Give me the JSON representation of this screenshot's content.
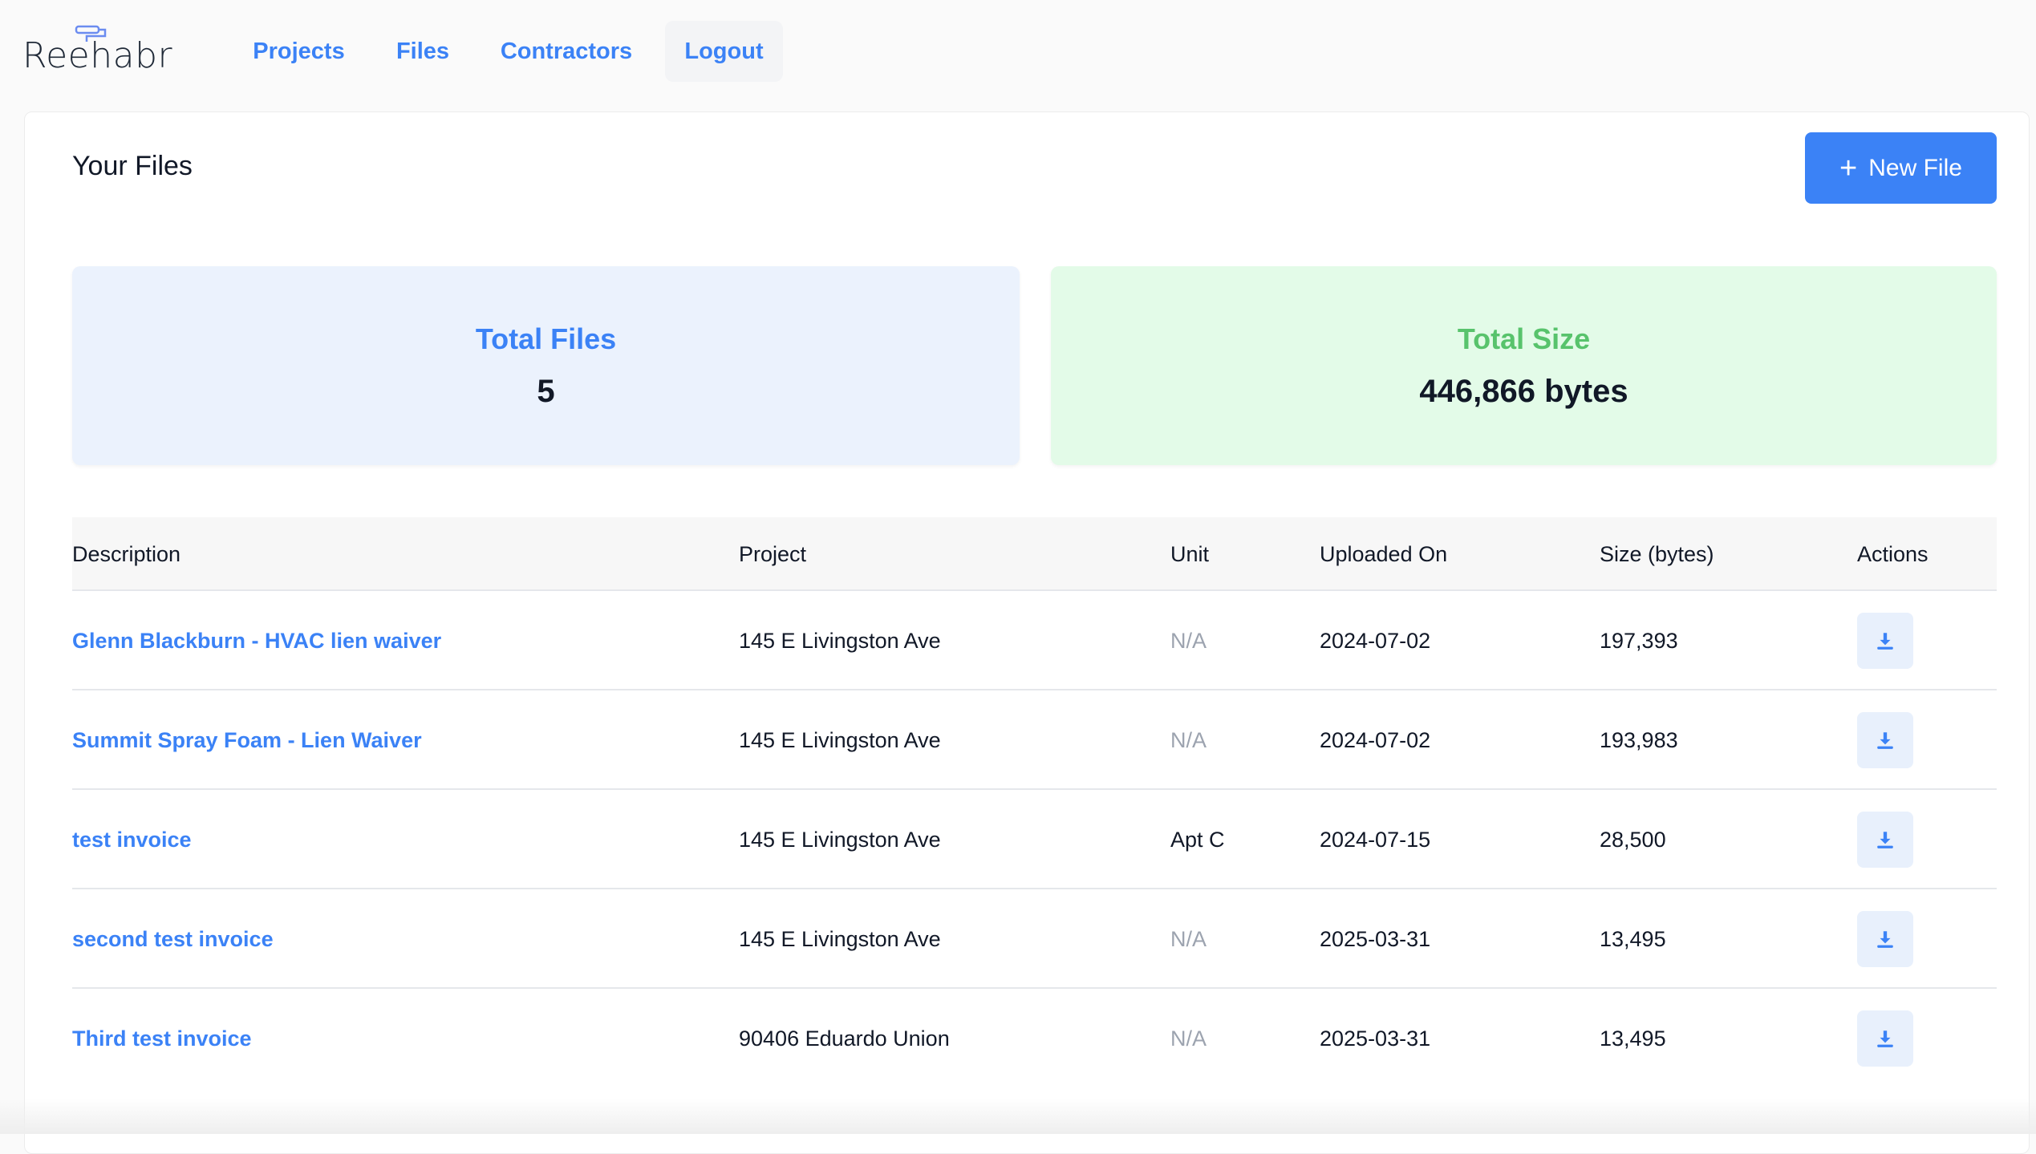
{
  "brand": {
    "name": "Reehabr"
  },
  "nav": {
    "items": [
      {
        "label": "Projects"
      },
      {
        "label": "Files"
      },
      {
        "label": "Contractors"
      },
      {
        "label": "Logout"
      }
    ]
  },
  "page": {
    "title": "Your Files",
    "new_button_label": "New File",
    "new_button_icon": "plus-icon"
  },
  "stats": {
    "total_files_label": "Total Files",
    "total_files_value": "5",
    "total_size_label": "Total Size",
    "total_size_value": "446,866 bytes"
  },
  "table": {
    "headers": [
      "Description",
      "Project",
      "Unit",
      "Uploaded On",
      "Size (bytes)",
      "Actions"
    ],
    "rows": [
      {
        "description": "Glenn Blackburn - HVAC lien waiver",
        "project": "145 E Livingston Ave",
        "unit": "N/A",
        "uploaded": "2024-07-02",
        "size": "197,393"
      },
      {
        "description": "Summit Spray Foam - Lien Waiver",
        "project": "145 E Livingston Ave",
        "unit": "N/A",
        "uploaded": "2024-07-02",
        "size": "193,983"
      },
      {
        "description": "test invoice",
        "project": "145 E Livingston Ave",
        "unit": "Apt C",
        "uploaded": "2024-07-15",
        "size": "28,500"
      },
      {
        "description": "second test invoice",
        "project": "145 E Livingston Ave",
        "unit": "N/A",
        "uploaded": "2025-03-31",
        "size": "13,495"
      },
      {
        "description": "Third test invoice",
        "project": "90406 Eduardo Union",
        "unit": "N/A",
        "uploaded": "2025-03-31",
        "size": "13,495"
      }
    ],
    "action_icon": "download-icon"
  },
  "colors": {
    "accent": "#3b82f6",
    "files_card_bg": "#ebf2fd",
    "size_card_bg": "#e3fbe8",
    "size_label": "#58c36c",
    "muted": "#9ca3af"
  }
}
